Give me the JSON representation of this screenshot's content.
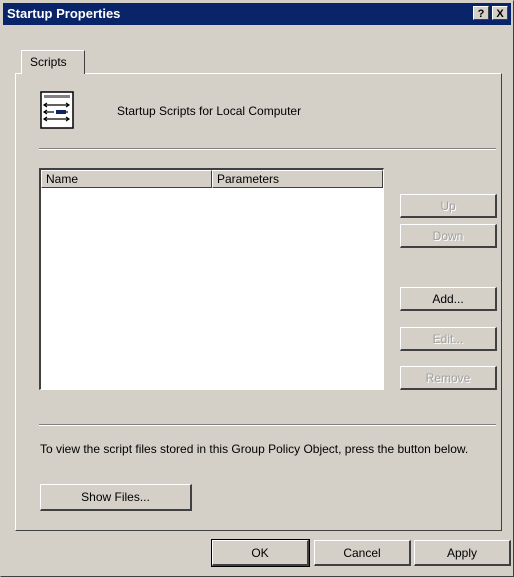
{
  "window": {
    "title": "Startup Properties",
    "help_label": "?",
    "close_label": "X"
  },
  "tabs": [
    {
      "label": "Scripts",
      "active": true
    }
  ],
  "header": {
    "icon": "script-file-icon",
    "text": "Startup Scripts for Local Computer"
  },
  "list": {
    "columns": [
      "Name",
      "Parameters"
    ],
    "rows": []
  },
  "side_buttons": {
    "up": {
      "label": "Up",
      "enabled": false
    },
    "down": {
      "label": "Down",
      "enabled": false
    },
    "add": {
      "label": "Add...",
      "enabled": true
    },
    "edit": {
      "label": "Edit...",
      "enabled": false
    },
    "remove": {
      "label": "Remove",
      "enabled": false
    }
  },
  "info": {
    "text": "To view the script files stored in this Group Policy Object, press the button below.",
    "show_files_label": "Show Files..."
  },
  "footer": {
    "ok_label": "OK",
    "cancel_label": "Cancel",
    "apply_label": "Apply"
  },
  "colors": {
    "titlebar": "#0a246a",
    "face": "#d4d0c8",
    "disabled_text": "#a0a0a0"
  }
}
